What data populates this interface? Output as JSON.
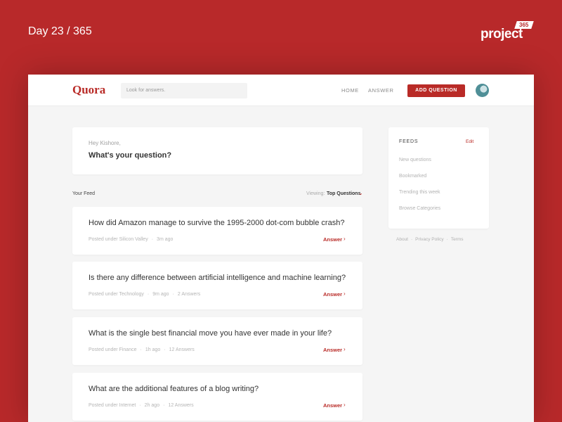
{
  "banner": {
    "day": "Day 23 / 365",
    "brand_word": "project",
    "brand_badge": "365"
  },
  "header": {
    "logo": "Quora",
    "search_placeholder": "Look for answers.",
    "nav": [
      "HOME",
      "ANSWER"
    ],
    "add_question": "ADD QUESTION"
  },
  "ask": {
    "greeting": "Hey Kishore,",
    "prompt": "What's your question?"
  },
  "feed": {
    "label": "Your Feed",
    "viewing_label": "Viewing:",
    "viewing_value": "Top Questions",
    "answer_label": "Answer",
    "questions": [
      {
        "title": "How did Amazon manage to survive the 1995-2000 dot-com bubble crash?",
        "posted": "Posted under Silicon Valley",
        "time": "3m ago",
        "answers": ""
      },
      {
        "title": "Is there any difference between artificial intelligence and machine learning?",
        "posted": "Posted under Technology",
        "time": "9m ago",
        "answers": "2 Answers"
      },
      {
        "title": "What is the single best financial move you have ever made in your life?",
        "posted": "Posted under Finance",
        "time": "1h ago",
        "answers": "12 Answers"
      },
      {
        "title": "What are the additional features of a blog writing?",
        "posted": "Posted under Internet",
        "time": "2h ago",
        "answers": "12 Answers"
      }
    ]
  },
  "sidebar": {
    "title": "FEEDS",
    "edit": "Edit",
    "items": [
      "New questions",
      "Bookmarked",
      "Trending this week",
      "Browse Categories"
    ]
  },
  "footer": {
    "links": [
      "About",
      "Privacy Policy",
      "Terms"
    ]
  },
  "colors": {
    "background": "#b8292a",
    "accent": "#b92b27"
  }
}
